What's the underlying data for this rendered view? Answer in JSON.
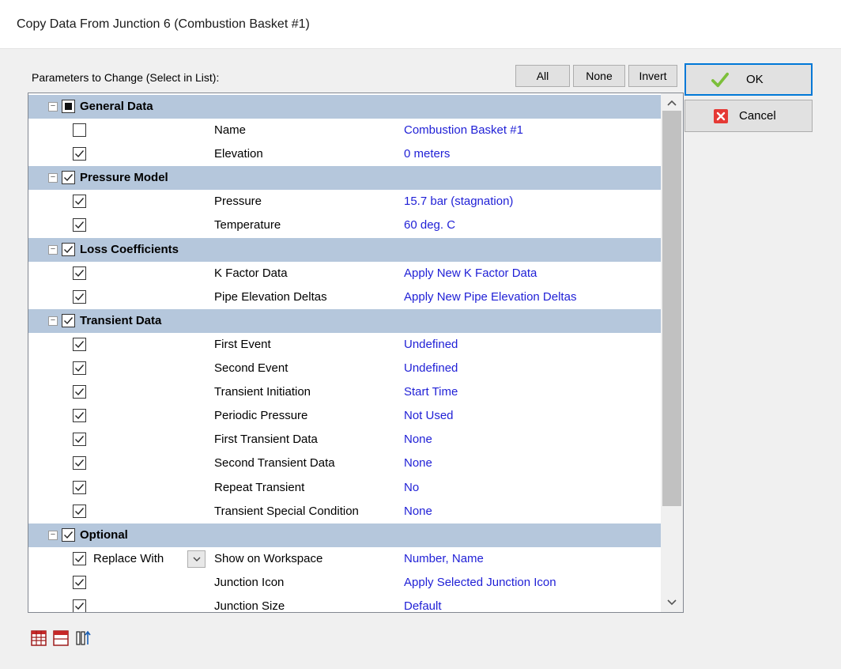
{
  "dialog": {
    "title": "Copy Data From Junction 6 (Combustion Basket #1)",
    "params_label": "Parameters to Change (Select in List):"
  },
  "header_buttons": {
    "all": "All",
    "none": "None",
    "invert": "Invert"
  },
  "side_buttons": {
    "ok": "OK",
    "cancel": "Cancel"
  },
  "groups": [
    {
      "label": "General Data",
      "state": "partial",
      "items": [
        {
          "name": "Name",
          "value": "Combustion Basket #1",
          "checked": false
        },
        {
          "name": "Elevation",
          "value": "0 meters",
          "checked": true
        }
      ]
    },
    {
      "label": "Pressure Model",
      "state": "checked",
      "items": [
        {
          "name": "Pressure",
          "value": "15.7 bar (stagnation)",
          "checked": true
        },
        {
          "name": "Temperature",
          "value": "60 deg. C",
          "checked": true
        }
      ]
    },
    {
      "label": "Loss Coefficients",
      "state": "checked",
      "items": [
        {
          "name": "K Factor Data",
          "value": "Apply New K Factor Data",
          "checked": true
        },
        {
          "name": "Pipe Elevation Deltas",
          "value": "Apply New Pipe Elevation Deltas",
          "checked": true
        }
      ]
    },
    {
      "label": "Transient Data",
      "state": "checked",
      "items": [
        {
          "name": "First Event",
          "value": "Undefined",
          "checked": true
        },
        {
          "name": "Second Event",
          "value": "Undefined",
          "checked": true
        },
        {
          "name": "Transient Initiation",
          "value": "Start Time",
          "checked": true
        },
        {
          "name": "Periodic Pressure",
          "value": "Not Used",
          "checked": true
        },
        {
          "name": "First Transient Data",
          "value": "None",
          "checked": true
        },
        {
          "name": "Second Transient Data",
          "value": "None",
          "checked": true
        },
        {
          "name": "Repeat Transient",
          "value": "No",
          "checked": true
        },
        {
          "name": "Transient Special Condition",
          "value": "None",
          "checked": true
        }
      ]
    },
    {
      "label": "Optional",
      "state": "checked",
      "items": [
        {
          "name": "Show on Workspace",
          "value": "Number, Name",
          "checked": true,
          "replace_with": "Replace With"
        },
        {
          "name": "Junction Icon",
          "value": "Apply Selected Junction Icon",
          "checked": true
        },
        {
          "name": "Junction Size",
          "value": "Default",
          "checked": true
        }
      ]
    }
  ],
  "icons": {
    "ok": "checkmark-icon",
    "cancel": "red-x-icon",
    "bottom": [
      "grid-icon",
      "table-header-icon",
      "sort-columns-icon"
    ]
  },
  "colors": {
    "group_header_bg": "#b5c7dc",
    "value_text": "#1f1fd6",
    "ok_border": "#0078d7",
    "ok_check": "#7cbf3a",
    "cancel_red": "#e53935"
  }
}
